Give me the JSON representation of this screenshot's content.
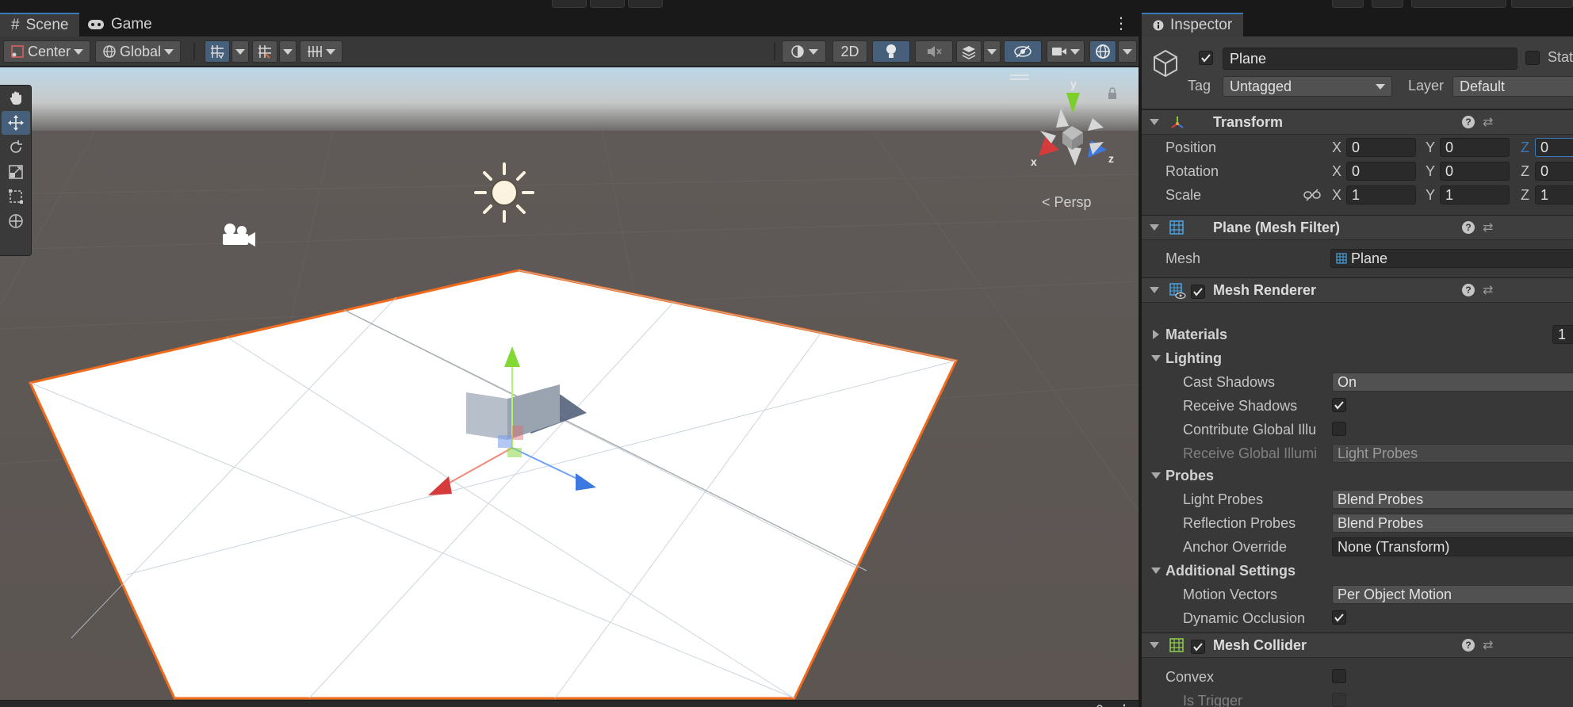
{
  "scene": {
    "tabs": [
      {
        "label": "Scene",
        "icon": "hash-icon",
        "active": true
      },
      {
        "label": "Game",
        "icon": "gamepad-icon",
        "active": false
      }
    ],
    "toolbar": {
      "pivot_label": "Center",
      "space_label": "Global",
      "mode_2d_label": "2D"
    },
    "projection_label": "Persp",
    "gizmo_axis_labels": {
      "x": "x",
      "y": "y",
      "z": "z"
    }
  },
  "inspector": {
    "tab_label": "Inspector",
    "object": {
      "name": "Plane",
      "active": true,
      "static_label": "Stati",
      "tag_label": "Tag",
      "tag_value": "Untagged",
      "layer_label": "Layer",
      "layer_value": "Default"
    },
    "transform": {
      "title": "Transform",
      "axes": [
        "X",
        "Y",
        "Z"
      ],
      "position_label": "Position",
      "position": [
        "0",
        "0",
        "0"
      ],
      "rotation_label": "Rotation",
      "rotation": [
        "0",
        "0",
        "0"
      ],
      "scale_label": "Scale",
      "scale": [
        "1",
        "1",
        "1"
      ]
    },
    "mesh_filter": {
      "title": "Plane (Mesh Filter)",
      "mesh_label": "Mesh",
      "mesh_value": "Plane"
    },
    "mesh_renderer": {
      "title": "Mesh Renderer",
      "enabled": true,
      "materials_label": "Materials",
      "materials_count": "1",
      "lighting_label": "Lighting",
      "cast_shadows_label": "Cast Shadows",
      "cast_shadows_value": "On",
      "receive_shadows_label": "Receive Shadows",
      "contribute_gi_label": "Contribute Global Illu",
      "receive_gi_label": "Receive Global Illumi",
      "receive_gi_value": "Light Probes",
      "probes_label": "Probes",
      "light_probes_label": "Light Probes",
      "light_probes_value": "Blend Probes",
      "reflection_probes_label": "Reflection Probes",
      "reflection_probes_value": "Blend Probes",
      "anchor_override_label": "Anchor Override",
      "anchor_override_value": "None (Transform)",
      "additional_settings_label": "Additional Settings",
      "motion_vectors_label": "Motion Vectors",
      "motion_vectors_value": "Per Object Motion",
      "dynamic_occlusion_label": "Dynamic Occlusion"
    },
    "mesh_collider": {
      "title": "Mesh Collider",
      "enabled": true,
      "convex_label": "Convex",
      "is_trigger_label": "Is Trigger"
    }
  },
  "colors": {
    "accent_blue": "#3a79bb",
    "selection_outline": "#f26a1b",
    "axis_x": "#d63b3b",
    "axis_y": "#7ccf2a",
    "axis_z": "#3b78e0"
  }
}
